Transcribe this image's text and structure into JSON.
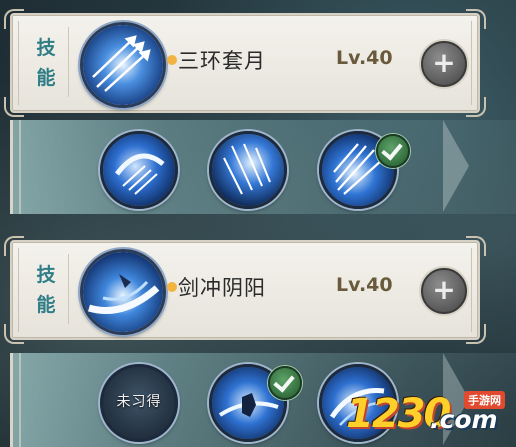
{
  "skills": [
    {
      "side_label": "技能",
      "name": "三环套月",
      "level": "Lv.40",
      "plus_label": "+",
      "icon": "triple-arrow-skill-icon",
      "runes": [
        {
          "icon": "crescent-sword-rune-icon",
          "equipped": false
        },
        {
          "icon": "falling-blades-rune-icon",
          "equipped": false
        },
        {
          "icon": "spread-blades-rune-icon",
          "equipped": true
        }
      ]
    },
    {
      "side_label": "技能",
      "name": "剑冲阴阳",
      "level": "Lv.40",
      "plus_label": "+",
      "icon": "sword-dash-skill-icon",
      "runes": [
        {
          "icon": "locked-rune-icon",
          "equipped": false,
          "locked_text": "未习得"
        },
        {
          "icon": "swordsman-rune-icon",
          "equipped": true
        },
        {
          "icon": "wind-slash-rune-icon",
          "equipped": false
        }
      ]
    }
  ],
  "watermark": {
    "number": "1230",
    "domain": ".com",
    "tag": "手游网"
  },
  "colors": {
    "accent_teal": "#2f7d86",
    "level_gold": "#6a5a3c",
    "bullet": "#f3b340",
    "check_green": "#3f8a4c"
  }
}
